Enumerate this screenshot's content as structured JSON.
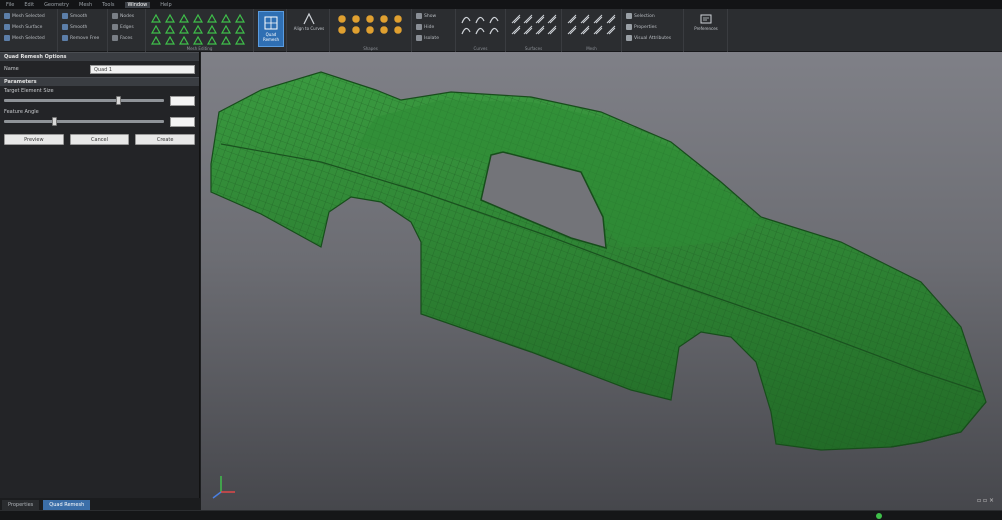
{
  "menubar": {
    "items": [
      "File",
      "Edit",
      "Geometry",
      "Mesh",
      "Tools",
      "Window",
      "Help"
    ],
    "active_index": 5
  },
  "ribbon": {
    "group1": {
      "buttons": [
        "Mesh Selected",
        "Mesh Surface",
        "Mesh Selected"
      ]
    },
    "group2": {
      "buttons": [
        "Smooth",
        "Smooth",
        "Remove Free"
      ]
    },
    "group3": {
      "buttons": [
        "Nodes",
        "Edges",
        "Faces"
      ]
    },
    "group4": {
      "label": "Mesh Editing"
    },
    "big_select": {
      "label": "Quad Remesh",
      "selected": true
    },
    "big_align": {
      "label": "Align to Curves"
    },
    "shapes_label": "Shapes",
    "group_view": {
      "buttons": [
        "Show",
        "Hide",
        "Isolate"
      ]
    },
    "curves_label": "Curves",
    "surfaces_label": "Surfaces",
    "mesh_label": "Mesh",
    "group_props": {
      "buttons": [
        "Selection",
        "Properties",
        "Visual Attributes"
      ]
    },
    "big_preferences": {
      "label": "Preferences"
    }
  },
  "panel": {
    "header1": "Quad Remesh Options",
    "name_label": "Name",
    "name_value": "Quad 1",
    "header2": "Parameters",
    "slider1_label": "Target Element Size",
    "slider1_value": 0.7,
    "slider2_label": "Feature Angle",
    "slider2_value": 0.3,
    "btn_preview": "Preview",
    "btn_cancel": "Cancel",
    "btn_create": "Create"
  },
  "tabs": [
    {
      "label": "Properties",
      "active": false
    },
    {
      "label": "Quad Remesh",
      "active": true
    }
  ],
  "colors": {
    "mesh_fill": "#2f8a34",
    "mesh_line": "#1d5a22",
    "selected": "#2f6fb3",
    "status_ok": "#3fbf4a"
  },
  "icons": [
    "mesh-icon",
    "smooth-icon",
    "node-icon",
    "quad-remesh-icon",
    "align-icon",
    "shapes-icon",
    "show-icon",
    "curve-icon",
    "surface-icon",
    "selection-icon",
    "preferences-icon",
    "axis-triad-icon"
  ]
}
